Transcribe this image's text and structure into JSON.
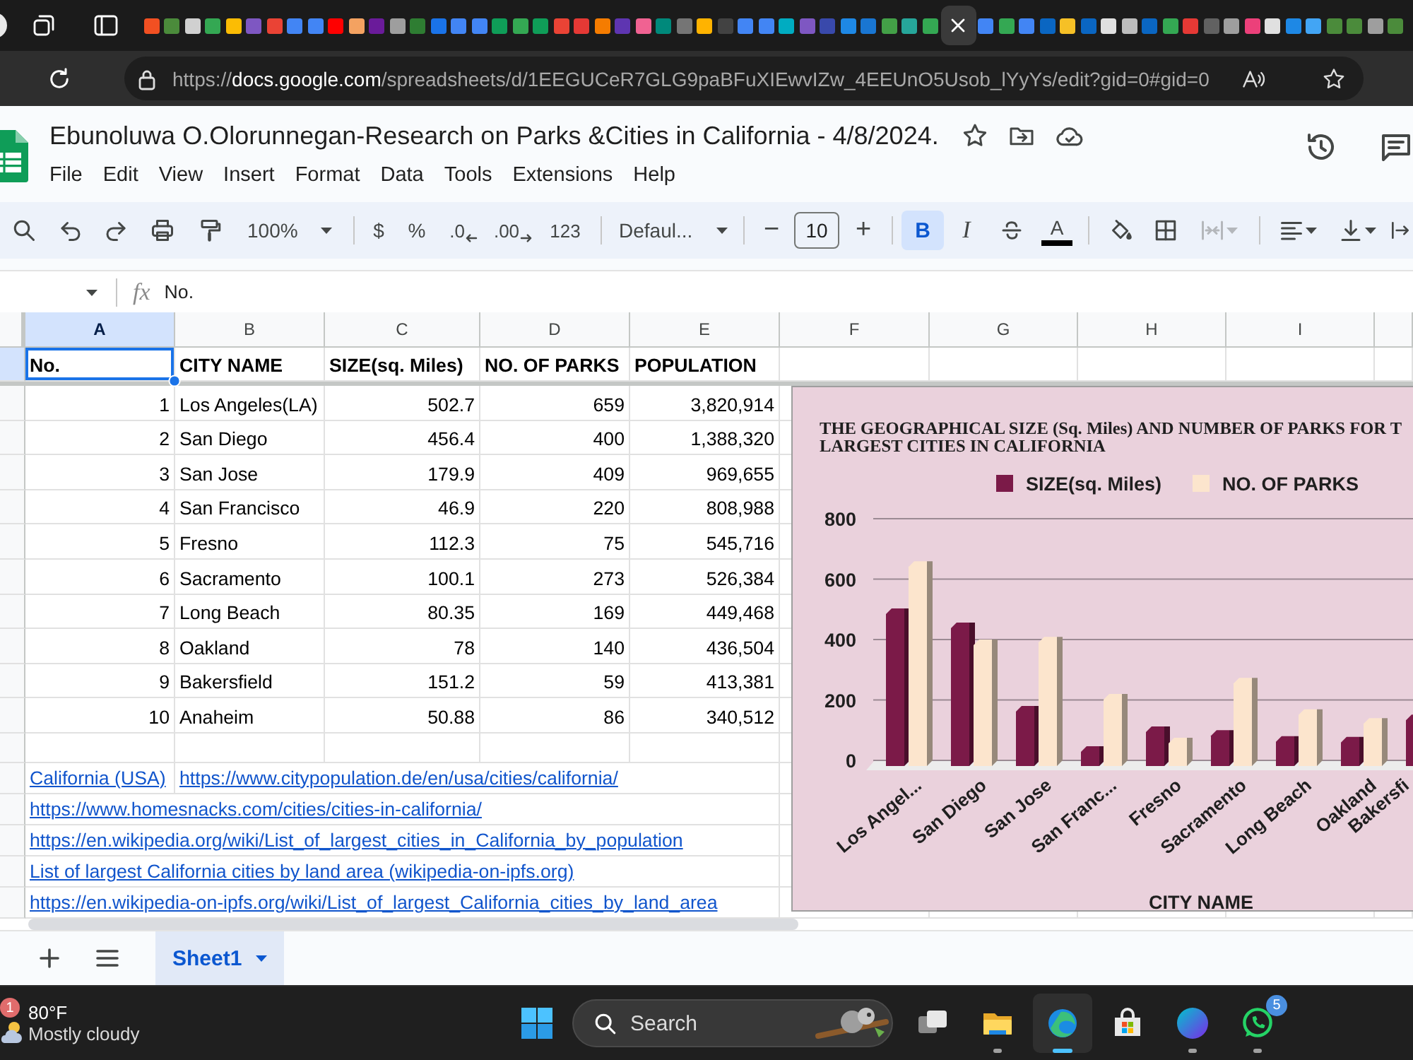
{
  "browser": {
    "tabs": [
      {
        "color": "#f25022",
        "selected": false
      },
      {
        "color": "#4b8b3b",
        "selected": false
      },
      {
        "color": "#d0d0d0",
        "selected": false
      },
      {
        "color": "#34a853",
        "selected": false
      },
      {
        "color": "#fbbc04",
        "selected": false
      },
      {
        "color": "#7e57c2",
        "selected": false
      },
      {
        "color": "#ea4335",
        "selected": false
      },
      {
        "color": "#4285f4",
        "selected": false
      },
      {
        "color": "#4285f4",
        "selected": false
      },
      {
        "color": "#ff0000",
        "selected": false
      },
      {
        "color": "#f4a261",
        "selected": false
      },
      {
        "color": "#6a1b9a",
        "selected": false
      },
      {
        "color": "#9e9e9e",
        "selected": false
      },
      {
        "color": "#2e7d32",
        "selected": false
      },
      {
        "color": "#1a73e8",
        "selected": false
      },
      {
        "color": "#4285f4",
        "selected": false
      },
      {
        "color": "#4285f4",
        "selected": false
      },
      {
        "color": "#0f9d58",
        "selected": false
      },
      {
        "color": "#34a853",
        "selected": false
      },
      {
        "color": "#0f9d58",
        "selected": false
      },
      {
        "color": "#ea4335",
        "selected": false
      },
      {
        "color": "#e53935",
        "selected": false
      },
      {
        "color": "#f57c00",
        "selected": false
      },
      {
        "color": "#5e35b1",
        "selected": false
      },
      {
        "color": "#f06292",
        "selected": false
      },
      {
        "color": "#00897b",
        "selected": false
      },
      {
        "color": "#757575",
        "selected": false
      },
      {
        "color": "#ffb300",
        "selected": false
      },
      {
        "color": "#424242",
        "selected": false
      },
      {
        "color": "#4285f4",
        "selected": false
      },
      {
        "color": "#4285f4",
        "selected": false
      },
      {
        "color": "#00acc1",
        "selected": false
      },
      {
        "color": "#7e57c2",
        "selected": false
      },
      {
        "color": "#3949ab",
        "selected": false
      },
      {
        "color": "#1e88e5",
        "selected": false
      },
      {
        "color": "#1976d2",
        "selected": false
      },
      {
        "color": "#43a047",
        "selected": false
      },
      {
        "color": "#26a69a",
        "selected": false
      },
      {
        "color": "#34a853",
        "selected": false
      },
      {
        "selected": true
      },
      {
        "color": "#4285f4",
        "selected": false
      },
      {
        "color": "#34a853",
        "selected": false
      },
      {
        "color": "#4285f4",
        "selected": false
      },
      {
        "color": "#0a66c2",
        "selected": false
      },
      {
        "color": "#f6c026",
        "selected": false
      },
      {
        "color": "#0a66c2",
        "selected": false
      },
      {
        "color": "#e0e0e0",
        "selected": false
      },
      {
        "color": "#bdbdbd",
        "selected": false
      },
      {
        "color": "#0a66c2",
        "selected": false
      },
      {
        "color": "#34a853",
        "selected": false
      },
      {
        "color": "#e53935",
        "selected": false
      },
      {
        "color": "#616161",
        "selected": false
      },
      {
        "color": "#9e9e9e",
        "selected": false
      },
      {
        "color": "#ec407a",
        "selected": false
      },
      {
        "color": "#e0e0e0",
        "selected": false
      },
      {
        "color": "#1e88e5",
        "selected": false
      },
      {
        "color": "#42a5f5",
        "selected": false
      },
      {
        "color": "#4b8b3b",
        "selected": false
      },
      {
        "color": "#4b8b3b",
        "selected": false
      },
      {
        "color": "#9e9e9e",
        "selected": false
      },
      {
        "color": "#4b8b3b",
        "selected": false
      }
    ],
    "url": {
      "scheme": "https://",
      "host": "docs.google.com",
      "path": "/spreadsheets/d/1EEGUCeR7GLG9paBFuXIEwvIZw_4EEUnO5Usob_lYyYs/edit?gid=0#gid=0"
    }
  },
  "document": {
    "title": "Ebunoluwa O.Olorunnegan-Research on Parks &Cities in California - 4/8/2024.",
    "menu": [
      "File",
      "Edit",
      "View",
      "Insert",
      "Format",
      "Data",
      "Tools",
      "Extensions",
      "Help"
    ]
  },
  "toolbar": {
    "zoom": "100%",
    "currency": "$",
    "percent": "%",
    "decrease_decimals": ".0",
    "increase_decimals": ".00",
    "number_format": "123",
    "font": "Defaul...",
    "font_size_minus": "−",
    "font_size": "10",
    "font_size_plus": "+",
    "bold": {
      "label": "B",
      "on": true
    },
    "italic": {
      "label": "I",
      "on": false
    },
    "text_color": "A",
    "merge_disabled": true
  },
  "formula_bar": {
    "label": "fx",
    "content": "No."
  },
  "sheet": {
    "columns": [
      {
        "label": "A",
        "selected": true
      },
      {
        "label": "B",
        "selected": false
      },
      {
        "label": "C",
        "selected": false
      },
      {
        "label": "D",
        "selected": false
      },
      {
        "label": "E",
        "selected": false
      },
      {
        "label": "F",
        "selected": false
      },
      {
        "label": "G",
        "selected": false
      },
      {
        "label": "H",
        "selected": false
      },
      {
        "label": "I",
        "selected": false
      }
    ],
    "header_row": {
      "selected": true,
      "cells": [
        "No.",
        "CITY NAME",
        "SIZE(sq. Miles)",
        "NO. OF PARKS",
        "POPULATION"
      ]
    },
    "rows": [
      {
        "selected": false,
        "cells": [
          "1",
          "Los Angeles(LA)",
          "502.7",
          "659",
          "3,820,914"
        ]
      },
      {
        "selected": false,
        "cells": [
          "2",
          "San Diego",
          "456.4",
          "400",
          "1,388,320"
        ]
      },
      {
        "selected": false,
        "cells": [
          "3",
          "San Jose",
          "179.9",
          "409",
          "969,655"
        ]
      },
      {
        "selected": false,
        "cells": [
          "4",
          "San Francisco",
          "46.9",
          "220",
          "808,988"
        ]
      },
      {
        "selected": false,
        "cells": [
          "5",
          "Fresno",
          "112.3",
          "75",
          "545,716"
        ]
      },
      {
        "selected": false,
        "cells": [
          "6",
          "Sacramento",
          "100.1",
          "273",
          "526,384"
        ]
      },
      {
        "selected": false,
        "cells": [
          "7",
          "Long Beach",
          "80.35",
          "169",
          "449,468"
        ]
      },
      {
        "selected": false,
        "cells": [
          "8",
          "Oakland",
          "78",
          "140",
          "436,504"
        ]
      },
      {
        "selected": false,
        "cells": [
          "9",
          "Bakersfield",
          "151.2",
          "59",
          "413,381"
        ]
      },
      {
        "selected": false,
        "cells": [
          "10",
          "Anaheim",
          "50.88",
          "86",
          "340,512"
        ]
      }
    ],
    "link_rows": [
      {
        "selected": false,
        "cells": [
          "California (USA)",
          "https://www.citypopulation.de/en/usa/cities/california/"
        ]
      },
      {
        "selected": false,
        "cells": [
          "https://www.homesnacks.com/cities/cities-in-california/"
        ]
      },
      {
        "selected": false,
        "cells": [
          "https://en.wikipedia.org/wiki/List_of_largest_cities_in_California_by_population"
        ]
      },
      {
        "selected": false,
        "cells": [
          "List of largest California cities by land area (wikipedia-on-ipfs.org)"
        ]
      },
      {
        "selected": false,
        "cells": [
          "https://en.wikipedia-on-ipfs.org/wiki/List_of_largest_California_cities_by_land_area"
        ]
      }
    ],
    "chart": {
      "chart_data": {
        "type": "bar",
        "title": "THE GEOGRAPHICAL SIZE (Sq. Miles) AND NUMBER OF PARKS FOR T\nLARGEST CITIES IN CALIFORNIA",
        "xlabel": "CITY NAME",
        "categories": [
          "Los Angel...",
          "San Diego",
          "San Jose",
          "San Franc...",
          "Fresno",
          "Sacramento",
          "Long Beach",
          "Oakland",
          "Bakersfi"
        ],
        "series": [
          {
            "name": "SIZE(sq. Miles)",
            "color": "#7b1a48",
            "values": [
              502.7,
              456.4,
              179.9,
              46.9,
              112.3,
              100.1,
              80.35,
              78,
              151.2
            ]
          },
          {
            "name": "NO. OF PARKS",
            "color": "#fce5cd",
            "values": [
              659,
              400,
              409,
              220,
              75,
              273,
              169,
              140,
              null
            ]
          }
        ],
        "ylim": [
          0,
          800
        ],
        "yticks": [
          {
            "value": 0,
            "label": "0"
          },
          {
            "value": 200,
            "label": "200"
          },
          {
            "value": 400,
            "label": "400"
          },
          {
            "value": 600,
            "label": "600"
          },
          {
            "value": 800,
            "label": "800"
          }
        ],
        "stacked": false,
        "grid": true,
        "legend": true
      }
    },
    "tabs": [
      {
        "label": "Sheet1",
        "selected": true
      }
    ]
  },
  "taskbar": {
    "weather": {
      "badge": "1",
      "temperature": "80°F",
      "condition": "Mostly cloudy"
    },
    "search_label": "Search",
    "apps": [
      {
        "running": false,
        "selected": false
      },
      {
        "running": true,
        "selected": false
      },
      {
        "running": true,
        "selected": true
      },
      {
        "running": false,
        "selected": false
      },
      {
        "running": true,
        "selected": false
      },
      {
        "running": true,
        "selected": false,
        "badge": "5"
      }
    ]
  }
}
